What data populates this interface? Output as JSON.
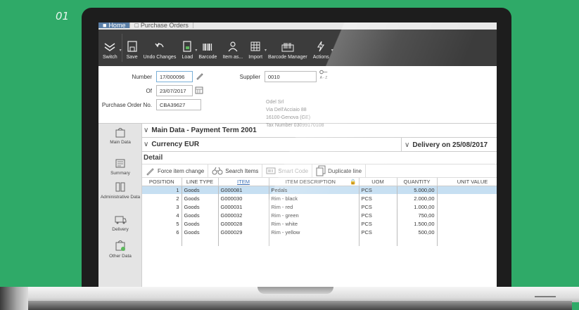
{
  "step_label": "01",
  "tabs": [
    {
      "label": "Home",
      "active": true
    },
    {
      "label": "Purchase Orders",
      "active": false
    }
  ],
  "toolbar": {
    "buttons": [
      {
        "label": "Switch",
        "icon": "chevrons-down-icon"
      },
      {
        "label": "Save",
        "icon": "save-icon"
      },
      {
        "label": "Undo Changes",
        "icon": "undo-icon"
      },
      {
        "label": "Load",
        "icon": "load-icon"
      },
      {
        "label": "Barcode",
        "icon": "barcode-icon"
      },
      {
        "label": "Item as...",
        "icon": "item-person-icon"
      },
      {
        "label": "Import",
        "icon": "grid-import-icon"
      },
      {
        "label": "Barcode Manager",
        "icon": "barcode-manager-icon"
      },
      {
        "label": "Actions",
        "icon": "lightning-icon"
      }
    ]
  },
  "form": {
    "number_label": "Number",
    "number_value": "17/000096",
    "of_label": "Of",
    "of_value": "23/07/2017",
    "po_label": "Purchase Order No.",
    "po_value": "CBA39627",
    "supplier_label": "Supplier",
    "supplier_value": "0010",
    "az_label": "A - Z",
    "supplier_address": [
      "Odel Srl",
      "Via Dell'Acciaio 88",
      "16100-Genova (GE)",
      "Tax Number 03099170108"
    ]
  },
  "sidebar": [
    {
      "label": "Main Data",
      "icon": "bag-icon"
    },
    {
      "label": "Summary",
      "icon": "summary-icon"
    },
    {
      "label": "Administrative Data",
      "icon": "columns-icon"
    },
    {
      "label": "Delivery",
      "icon": "delivery-icon"
    },
    {
      "label": "Other Data",
      "icon": "bag-plus-icon"
    }
  ],
  "sections": {
    "main_data": "Main Data - Payment Term 2001",
    "currency": "Currency EUR",
    "delivery": "Delivery on 25/08/2017",
    "detail": "Detail"
  },
  "actions": {
    "force": "Force item change",
    "search": "Search Items",
    "smart": "Smart Code",
    "duplicate": "Duplicate line"
  },
  "table": {
    "headers": [
      "POSITION",
      "LINE TYPE",
      "ITEM",
      "ITEM DESCRIPTION",
      "UOM",
      "QUANTITY",
      "UNIT VALUE"
    ],
    "rows": [
      [
        "1",
        "Goods",
        "G000081",
        "Pedals",
        "PCS",
        "5.000,00"
      ],
      [
        "2",
        "Goods",
        "G000030",
        "Rim - black",
        "PCS",
        "2.000,00"
      ],
      [
        "3",
        "Goods",
        "G000031",
        "Rim - red",
        "PCS",
        "1.000,00"
      ],
      [
        "4",
        "Goods",
        "G000032",
        "Rim - green",
        "PCS",
        "750,00"
      ],
      [
        "5",
        "Goods",
        "G000028",
        "Rim - white",
        "PCS",
        "1.500,00"
      ],
      [
        "6",
        "Goods",
        "G000029",
        "Rim - yellow",
        "PCS",
        "500,00"
      ]
    ]
  },
  "colors": {
    "background": "#2faa68",
    "toolbar": "#3c3c3c",
    "selected_row": "#c6dff2",
    "link": "#3b6fb6"
  }
}
